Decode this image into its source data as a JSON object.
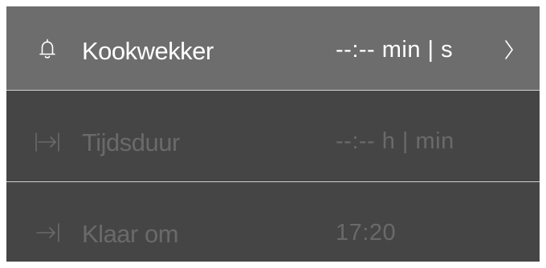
{
  "rows": [
    {
      "icon": "bell-icon",
      "label": "Kookwekker",
      "value": "--:--  min | s",
      "state": "active",
      "has_chevron": true
    },
    {
      "icon": "duration-icon",
      "label": "Tijdsduur",
      "value": "--:--  h | min",
      "state": "disabled",
      "has_chevron": false
    },
    {
      "icon": "end-time-icon",
      "label": "Klaar om",
      "value": "17:20",
      "state": "disabled",
      "has_chevron": false
    }
  ],
  "colors": {
    "active_row_bg": "#6d6d6d",
    "inactive_row_bg": "#454545",
    "active_text": "#ffffff",
    "disabled_text": "#6a6a6a",
    "divider": "#cfcfcf"
  }
}
